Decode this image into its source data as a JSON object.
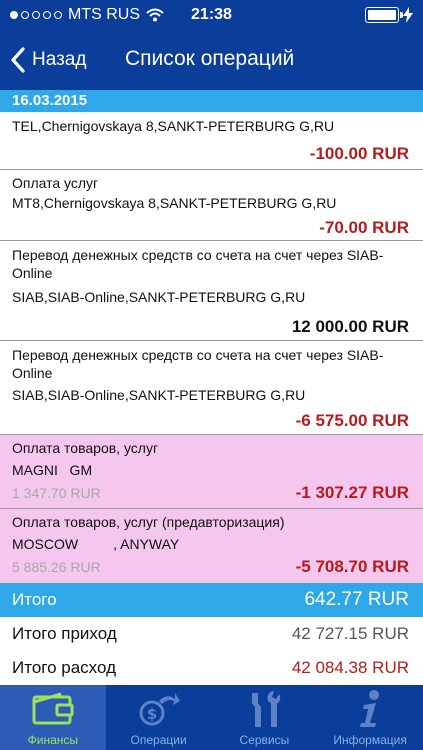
{
  "status": {
    "carrier": "MTS RUS",
    "time": "21:38"
  },
  "nav": {
    "back_label": "Назад",
    "title": "Список операций"
  },
  "date_section": "16.03.2015",
  "transactions": [
    {
      "title": "",
      "merchant": "TEL,Chernigovskaya 8,SANKT-PETERBURG G,RU",
      "amount": "-100.00 RUR",
      "hold": ""
    },
    {
      "title": "Оплата услуг",
      "merchant": "MT8,Chernigovskaya 8,SANKT-PETERBURG G,RU",
      "amount": "-70.00 RUR",
      "hold": ""
    },
    {
      "title": "Перевод денежных средств со счета на счет через SIAB-Online",
      "merchant": "SIAB,SIAB-Online,SANKT-PETERBURG G,RU",
      "amount": "12 000.00 RUR",
      "hold": ""
    },
    {
      "title": "Перевод денежных средств со счета на счет через SIAB-Online",
      "merchant": "SIAB,SIAB-Online,SANKT-PETERBURG G,RU",
      "amount": "-6 575.00 RUR",
      "hold": ""
    },
    {
      "title": "Оплата товаров, услуг",
      "merchant": "MAGNI   GM",
      "amount": "-1 307.27 RUR",
      "hold": "1 347.70 RUR"
    },
    {
      "title": "Оплата товаров, услуг (предавторизация)",
      "merchant": "MOSCOW         , ANYWAY",
      "amount": "-5 708.70 RUR",
      "hold": "5 885.26 RUR"
    }
  ],
  "totals": {
    "total_label": "Итого",
    "total_value": "642.77 RUR",
    "income_label": "Итого приход",
    "income_value": "42 727.15 RUR",
    "expense_label": "Итого расход",
    "expense_value": "42 084.38 RUR"
  },
  "tabs": [
    {
      "label": "Финансы",
      "icon": "wallet-icon"
    },
    {
      "label": "Операции",
      "icon": "transfer-icon"
    },
    {
      "label": "Сервисы",
      "icon": "tools-icon"
    },
    {
      "label": "Информация",
      "icon": "info-icon"
    }
  ],
  "colors": {
    "header": "#0a3e9a",
    "accent": "#2ea8e8",
    "negative": "#b31d1d",
    "pending_row": "#f5c6ee",
    "active_tab_label": "#9fe25a"
  }
}
